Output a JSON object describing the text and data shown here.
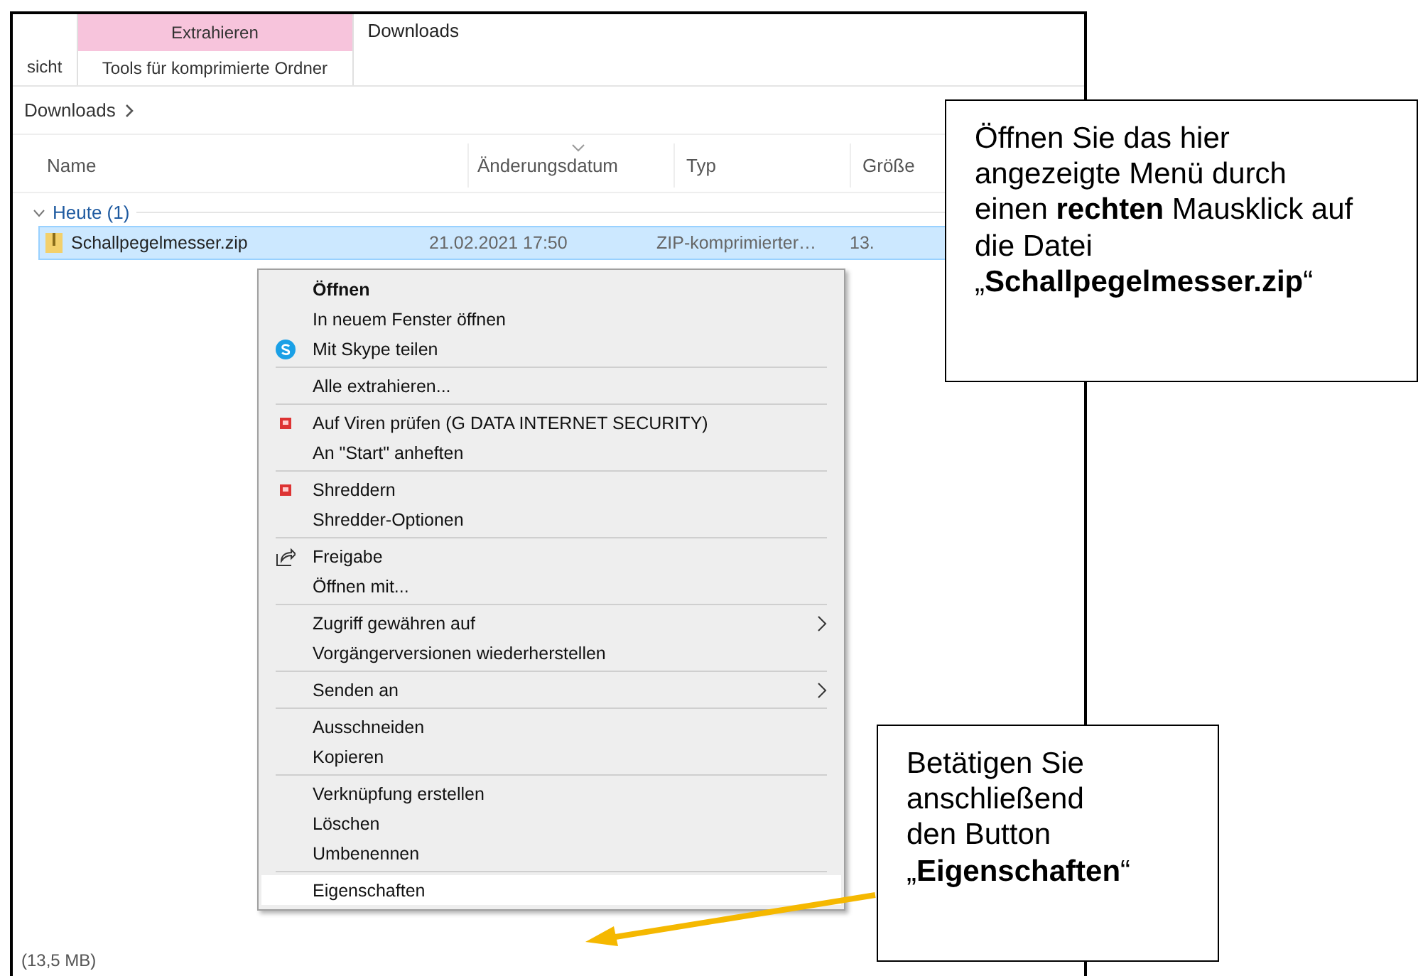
{
  "ribbon": {
    "tabs": [
      {
        "label": "sicht",
        "selected": false
      },
      {
        "label": "Tools für komprimierte Ordner",
        "selected": true
      }
    ],
    "context_header": "Extrahieren",
    "title": "Downloads"
  },
  "address": {
    "crumb": "Downloads"
  },
  "columns": [
    {
      "label": "Name",
      "sorted": false
    },
    {
      "label": "Änderungsdatum",
      "sorted": true
    },
    {
      "label": "Typ",
      "sorted": false
    },
    {
      "label": "Größe",
      "sorted": false
    }
  ],
  "groups": [
    {
      "label": "Heute (1)",
      "expanded": true,
      "rows": [
        {
          "name": "Schallpegelmesser.zip",
          "date": "21.02.2021 17:50",
          "type": "ZIP-komprimierter…",
          "size": "13.",
          "selected": true
        }
      ]
    }
  ],
  "status_bar": {
    "text": "(13,5 MB)"
  },
  "context_menu": {
    "groups": [
      [
        {
          "label": "Öffnen",
          "kind": "bold",
          "selected": false
        },
        {
          "label": "In neuem Fenster öffnen",
          "kind": "plain",
          "selected": false
        },
        {
          "label": "Mit Skype teilen",
          "kind": "app-icon",
          "selected": false
        }
      ],
      [
        {
          "label": "Alle extrahieren...",
          "kind": "plain",
          "selected": false
        }
      ],
      [
        {
          "label": "Auf Viren prüfen (G DATA INTERNET SECURITY)",
          "kind": "red-icon",
          "selected": false
        },
        {
          "label": "An \"Start\" anheften",
          "kind": "plain",
          "selected": false
        }
      ],
      [
        {
          "label": "Shreddern",
          "kind": "red-icon",
          "selected": false
        },
        {
          "label": "Shredder-Optionen",
          "kind": "plain",
          "selected": false
        }
      ],
      [
        {
          "label": "Freigabe",
          "kind": "share-icon",
          "selected": false
        },
        {
          "label": "Öffnen mit...",
          "kind": "plain",
          "selected": false
        }
      ],
      [
        {
          "label": "Zugriff gewähren auf",
          "kind": "submenu",
          "selected": false
        },
        {
          "label": "Vorgängerversionen wiederherstellen",
          "kind": "plain",
          "selected": false
        }
      ],
      [
        {
          "label": "Senden an",
          "kind": "submenu",
          "selected": false
        }
      ],
      [
        {
          "label": "Ausschneiden",
          "kind": "plain",
          "selected": false
        },
        {
          "label": "Kopieren",
          "kind": "plain",
          "selected": false
        }
      ],
      [
        {
          "label": "Verknüpfung erstellen",
          "kind": "plain",
          "selected": false
        },
        {
          "label": "Löschen",
          "kind": "plain",
          "selected": false
        },
        {
          "label": "Umbenennen",
          "kind": "plain",
          "selected": false
        }
      ],
      [
        {
          "label": "Eigenschaften",
          "kind": "plain",
          "selected": true
        }
      ]
    ]
  },
  "callouts": [
    {
      "text": "Öffnen Sie das hier angezeigte Menü durch einen **rechten** Mausklick auf die Datei „**Schallpegelmesser.zip**“"
    },
    {
      "text": "Betätigen Sie anschließend den Button „**Eigenschaften**“"
    }
  ]
}
